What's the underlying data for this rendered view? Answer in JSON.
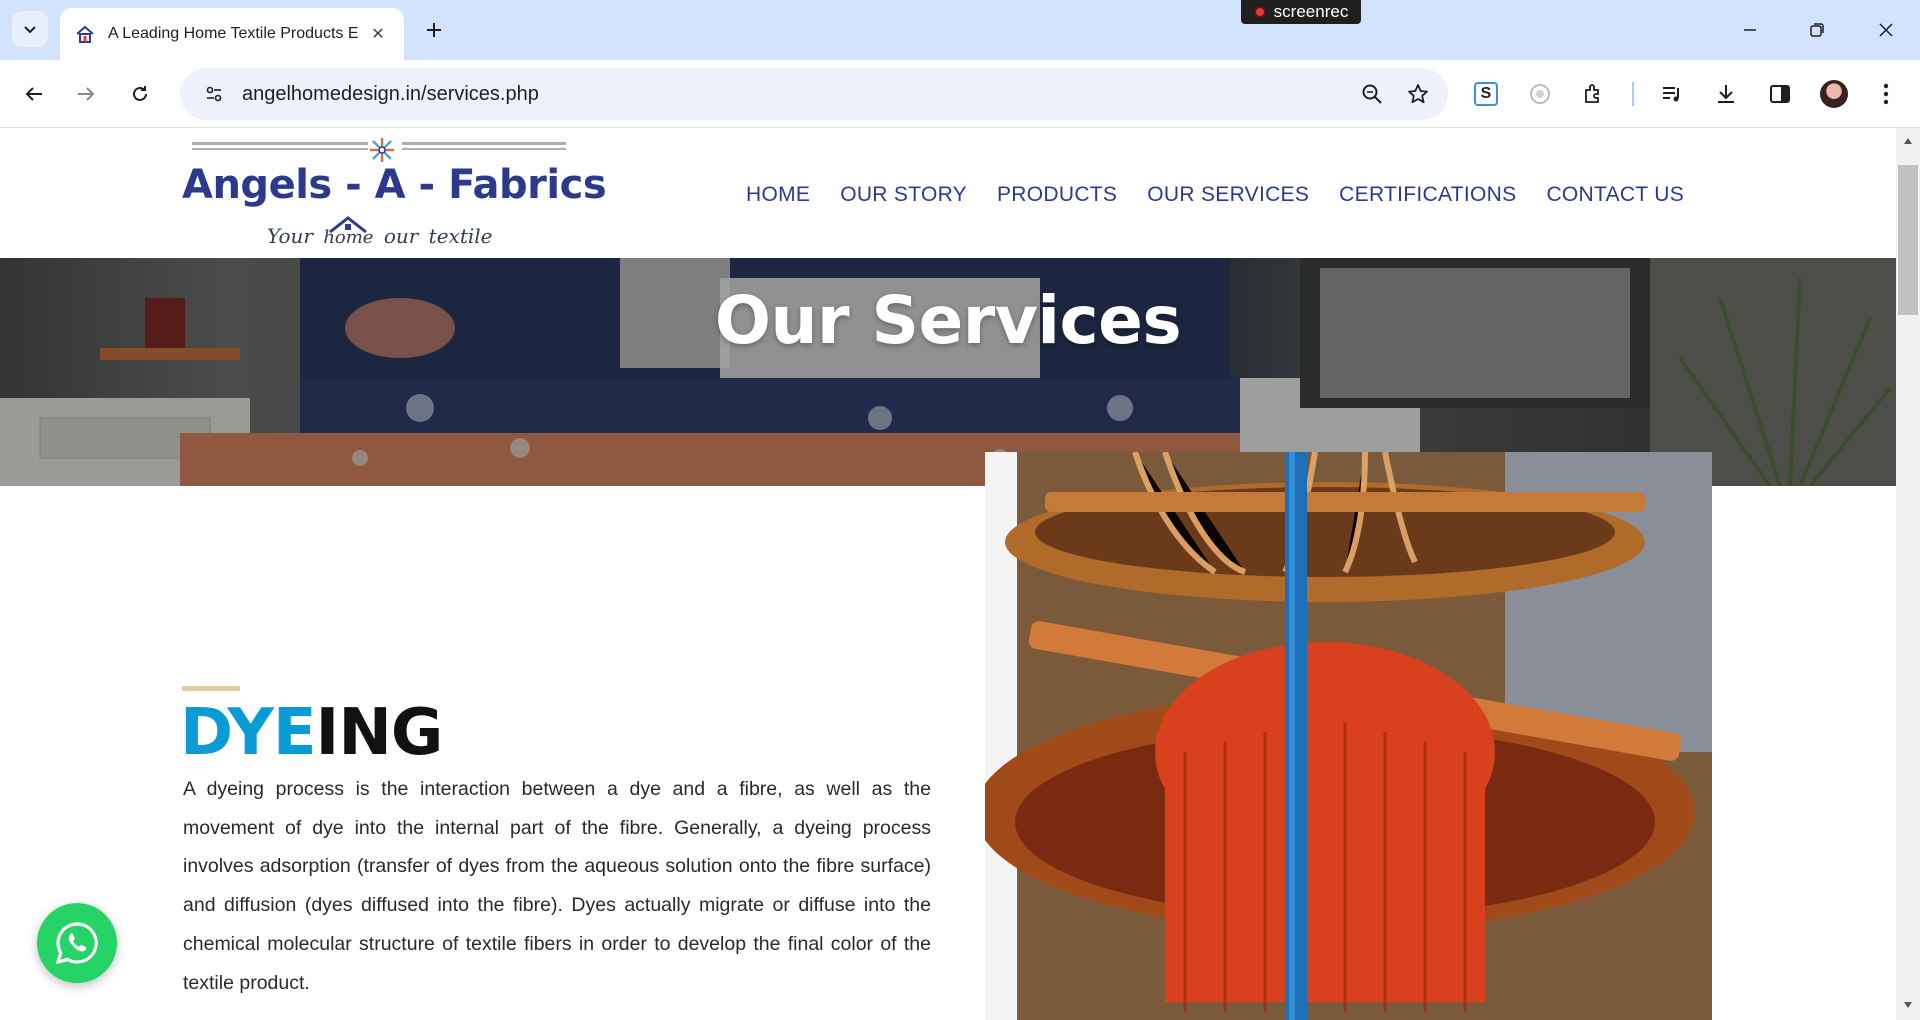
{
  "browser": {
    "tab": {
      "title": "A Leading Home Textile Products E"
    },
    "url": "angelhomedesign.in/services.php",
    "recorder_label": "screenrec"
  },
  "site": {
    "logo": {
      "title": "Angels - A - Fabrics",
      "tagline_left": "Your",
      "tagline_home": "home",
      "tagline_right": "our textile"
    },
    "nav": [
      "HOME",
      "OUR STORY",
      "PRODUCTS",
      "OUR SERVICES",
      "CERTIFICATIONS",
      "CONTACT US"
    ],
    "hero_title": "Our Services",
    "section": {
      "title_highlight": "DYE",
      "title_rest": "ING",
      "body": "A dyeing process is the interaction between a dye and a fibre, as well as the movement of dye into the internal part of the fibre. Generally, a dyeing process involves adsorption (transfer of dyes from the aqueous solution onto the fibre surface) and diffusion (dyes diffused into the fibre). Dyes actually migrate or diffuse into the chemical molecular structure of textile fibers in order to develop the final color of the textile product."
    }
  },
  "colors": {
    "brand": "#2b3a8c",
    "accent": "#0a9bd6",
    "whatsapp": "#25d366"
  }
}
